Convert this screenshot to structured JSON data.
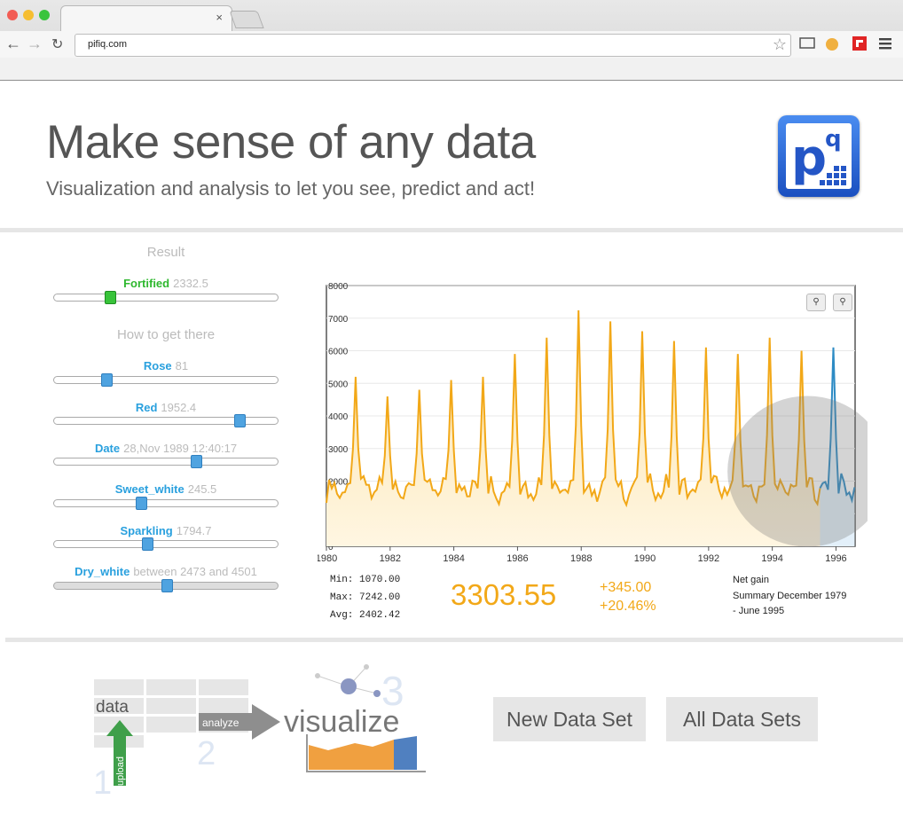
{
  "browser": {
    "url": "pifiq.com",
    "tab_close": "×"
  },
  "hero": {
    "title": "Make sense of any data",
    "subtitle": "Visualization and analysis to let you see, predict and act!",
    "logo_text": "pq"
  },
  "result": {
    "heading": "Result",
    "slider": {
      "name": "Fortified",
      "value": "2332.5",
      "level": 0.25
    }
  },
  "how": {
    "heading": "How to get there",
    "sliders": [
      {
        "name": "Rose",
        "value": "81",
        "level": 0.23
      },
      {
        "name": "Red",
        "value": "1952.4",
        "level": 0.83
      },
      {
        "name": "Date",
        "value": "28,Nov 1989 12:40:17",
        "level": 0.63
      },
      {
        "name": "Sweet_white",
        "value": "245.5",
        "level": 0.39
      },
      {
        "name": "Sparkling",
        "value": "1794.7",
        "level": 0.42
      },
      {
        "name": "Dry_white",
        "value": "between 2473 and 4501",
        "level": 0.5
      }
    ]
  },
  "chart_data": {
    "type": "area",
    "x_ticks": [
      "1980",
      "1982",
      "1984",
      "1986",
      "1988",
      "1990",
      "1992",
      "1994",
      "1996"
    ],
    "y_ticks": [
      "0",
      "1000",
      "2000",
      "3000",
      "4000",
      "5000",
      "6000",
      "7000",
      "8000"
    ],
    "xlim": [
      1980,
      1996.6
    ],
    "ylim": [
      0,
      8000
    ],
    "peaks": [
      {
        "x": 1980.9,
        "y": 5200
      },
      {
        "x": 1981.9,
        "y": 4600
      },
      {
        "x": 1982.9,
        "y": 4800
      },
      {
        "x": 1983.9,
        "y": 5100
      },
      {
        "x": 1984.9,
        "y": 5200
      },
      {
        "x": 1985.9,
        "y": 5900
      },
      {
        "x": 1986.9,
        "y": 6400
      },
      {
        "x": 1987.9,
        "y": 7242
      },
      {
        "x": 1988.9,
        "y": 6900
      },
      {
        "x": 1989.9,
        "y": 6600
      },
      {
        "x": 1990.9,
        "y": 6300
      },
      {
        "x": 1991.9,
        "y": 6100
      },
      {
        "x": 1992.9,
        "y": 5900
      },
      {
        "x": 1993.9,
        "y": 6400
      },
      {
        "x": 1994.9,
        "y": 6000
      },
      {
        "x": 1995.9,
        "y": 6100
      }
    ],
    "split_x": 1995.5,
    "colors": {
      "history": "#f2a818",
      "forecast": "#2d8bc4"
    },
    "stats": {
      "min": "Min: 1070.00",
      "max": "Max: 7242.00",
      "avg": "Avg: 2402.42"
    },
    "current": "3303.55",
    "delta_abs": "+345.00",
    "delta_pct": "+20.46%",
    "net_gain": "Net gain",
    "summary_1": "Summary December 1979",
    "summary_2": "- June 1995"
  },
  "flow": {
    "data_label": "data",
    "upload_label": "upload",
    "analyze_label": "analyze",
    "visualize_label": "visualize",
    "step1": "1",
    "step2": "2",
    "step3": "3"
  },
  "buttons": {
    "new": "New Data Set",
    "all": "All Data Sets"
  }
}
